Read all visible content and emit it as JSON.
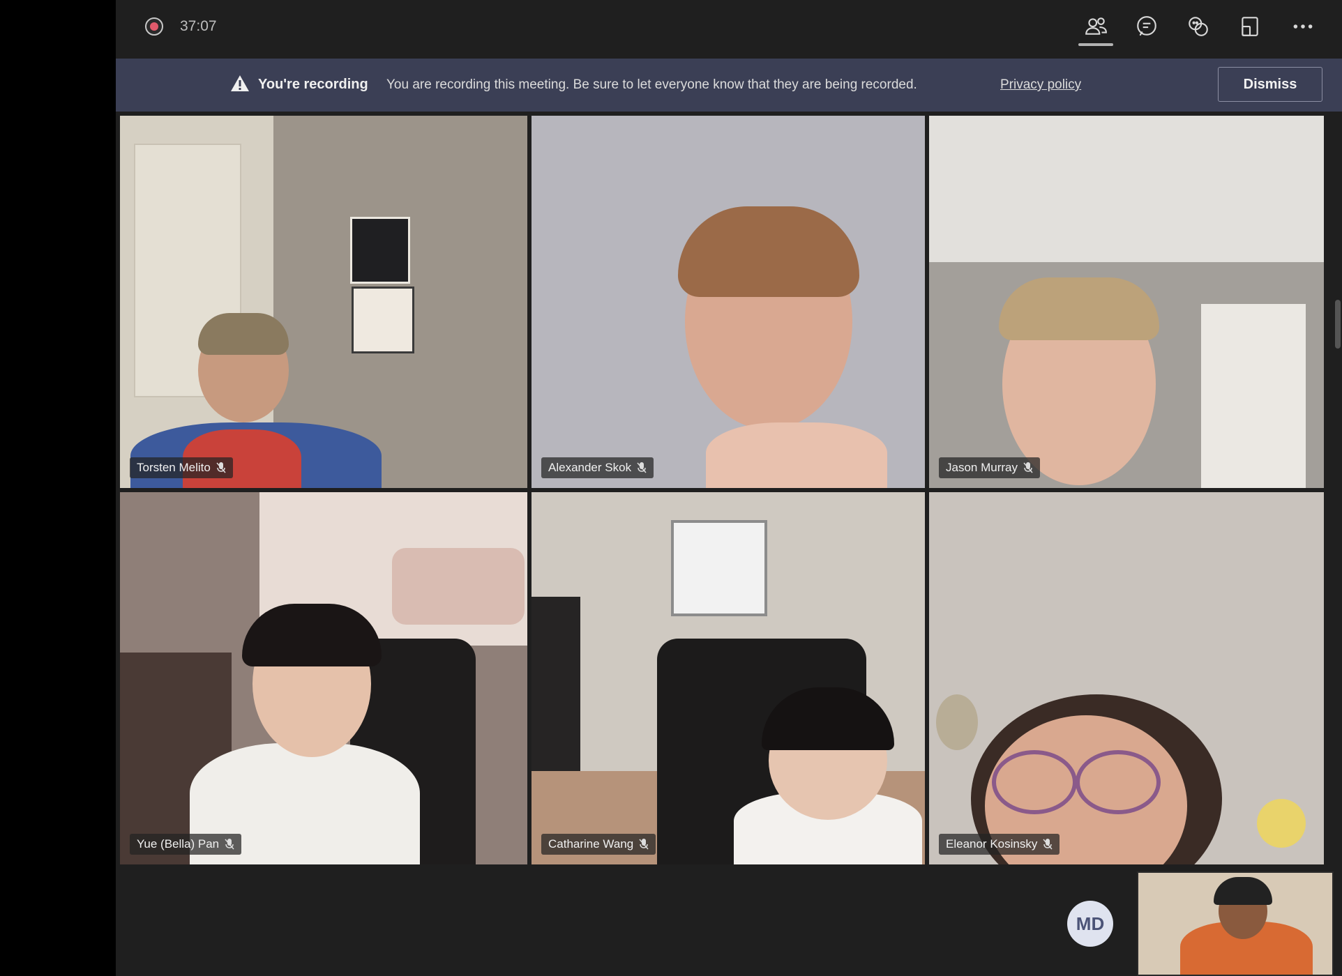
{
  "topbar": {
    "timer": "37:07",
    "icons": [
      "participants-icon",
      "chat-icon",
      "reactions-icon",
      "share-icon",
      "more-icon"
    ]
  },
  "banner": {
    "title": "You're recording",
    "text": "You are recording this meeting. Be sure to let everyone know that they are being recorded.",
    "link": "Privacy policy",
    "dismiss_label": "Dismiss"
  },
  "participants": [
    {
      "name": "Torsten Melito"
    },
    {
      "name": "Alexander Skok"
    },
    {
      "name": "Jason Murray"
    },
    {
      "name": "Yue (Bella) Pan"
    },
    {
      "name": "Catharine Wang"
    },
    {
      "name": "Eleanor Kosinsky"
    }
  ],
  "bottom": {
    "avatar_initials": "MD"
  },
  "colors": {
    "banner_bg": "#3b3f55",
    "app_bg": "#1f1f1f",
    "recording_red": "#e05a6b"
  }
}
